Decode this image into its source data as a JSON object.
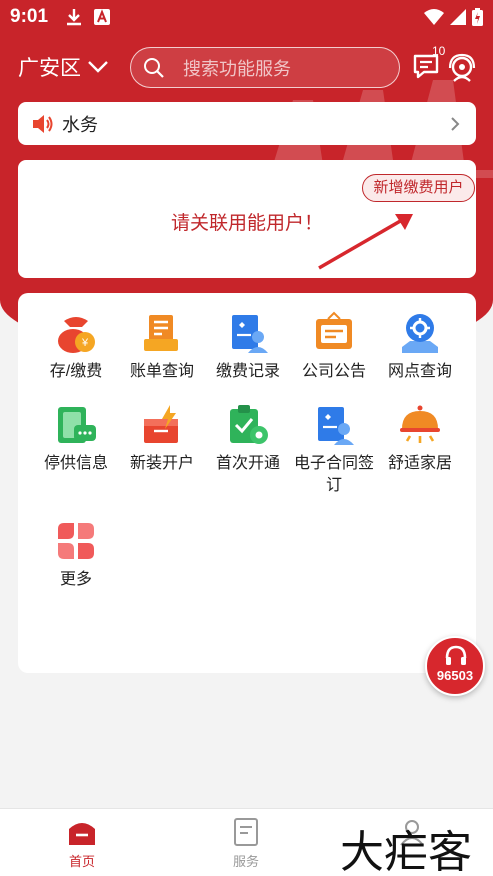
{
  "status_bar": {
    "time": "9:01"
  },
  "header": {
    "district": "广安区",
    "search_placeholder": "搜索功能服务",
    "message_badge": "10"
  },
  "notice": {
    "text": "水务"
  },
  "bind_card": {
    "message": "请关联用能用户！",
    "add_user_label": "新增缴费用户"
  },
  "functions": [
    {
      "label": "存/缴费",
      "icon": "money-bag-icon"
    },
    {
      "label": "账单查询",
      "icon": "bill-icon"
    },
    {
      "label": "缴费记录",
      "icon": "payment-record-icon"
    },
    {
      "label": "公司公告",
      "icon": "announcement-icon"
    },
    {
      "label": "网点查询",
      "icon": "location-icon"
    },
    {
      "label": "停供信息",
      "icon": "outage-info-icon"
    },
    {
      "label": "新装开户",
      "icon": "new-account-icon"
    },
    {
      "label": "首次开通",
      "icon": "first-activation-icon"
    },
    {
      "label": "电子合同签订",
      "icon": "e-contract-icon"
    },
    {
      "label": "舒适家居",
      "icon": "comfort-home-icon"
    },
    {
      "label": "更多",
      "icon": "more-icon"
    }
  ],
  "hotline": {
    "number": "96503"
  },
  "tabbar": {
    "tabs": [
      {
        "label": "首页",
        "active": true
      },
      {
        "label": "服务",
        "active": false
      }
    ]
  },
  "watermark": "大疟客",
  "colors": {
    "brand": "#c8242a",
    "background": "#f3f3f3"
  }
}
